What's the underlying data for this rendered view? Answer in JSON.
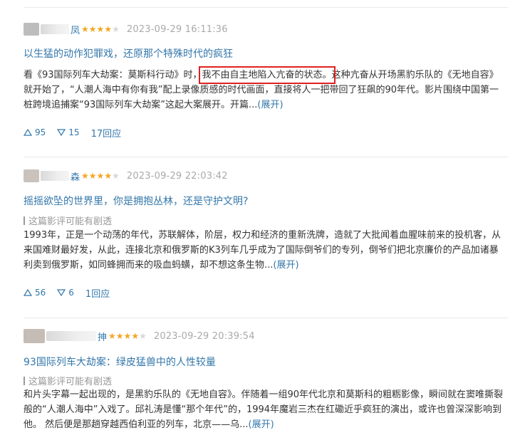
{
  "reviews": [
    {
      "username": "凤",
      "rating": 4,
      "time": "2023-09-29 16:11:36",
      "title": "以生猛的动作犯罪戏，还原那个特殊时代的疯狂",
      "spoiler": "",
      "body_prefix": "看《93国际列车大劫案：莫斯科行动》时，",
      "body_highlight": "我不由自主地陷入亢奋的状态。",
      "body_rest": "这种亢奋从开场黑豹乐队的《无地自容》就开始了，“人潮人海中有你有我”配上录像质感的时代画面，直接将人一把带回了狂飙的90年代。影片围绕中国第一桩跨境追捕案“93国际列车大劫案”这起大案展开。开篇...",
      "expand": "(展开)",
      "up_count": "95",
      "down_count": "15",
      "reply": "17回应"
    },
    {
      "username": "森",
      "rating": 4,
      "time": "2023-09-29 22:03:42",
      "title": "摇摇欲坠的世界里，你是拥抱丛林，还是守护文明?",
      "spoiler": "这篇影评可能有剧透",
      "body_prefix": "1993年，正是一个动荡的年代，苏联解体，阶层，权力和经济的重新洗牌，造就了大批闻着血腥味前来的投机客，从来国难财最好发，从此，连接北京和俄罗斯的K3列车几乎成为了国际倒爷们的专列，倒爷们把北京廉价的产品加诸暴利卖到俄罗斯，如同蜂拥而来的吸血蚂蟥，却不想这条生物...",
      "body_highlight": "",
      "body_rest": "",
      "expand": "(展开)",
      "up_count": "56",
      "down_count": "6",
      "reply": "1回应"
    },
    {
      "username": "抻",
      "rating": 4,
      "time": "2023-09-29 20:39:54",
      "title": "93国际列车大劫案：绿皮猛兽中的人性较量",
      "spoiler": "这篇影评可能有剧透",
      "body_prefix": "和片头字幕一起出现的，是黑豹乐队的《无地自容》。伴随着一组90年代北京和莫斯科的粗粝影像，瞬间就在窦唯撕裂般的“人潮人海中”入戏了。邱礼涛是懂“那个年代”的，1994年魔岩三杰在红磡近乎疯狂的演出，或许也曾深深影响到他。 然后便是那趟穿越西伯利亚的列车，北京——乌...",
      "body_highlight": "",
      "body_rest": "",
      "expand": "(展开)",
      "up_count": "",
      "down_count": "",
      "reply": ""
    }
  ],
  "colors": {
    "link": "#3377aa",
    "star": "#f5a623",
    "highlight_border": "#e02020",
    "muted": "#aaaaaa"
  }
}
